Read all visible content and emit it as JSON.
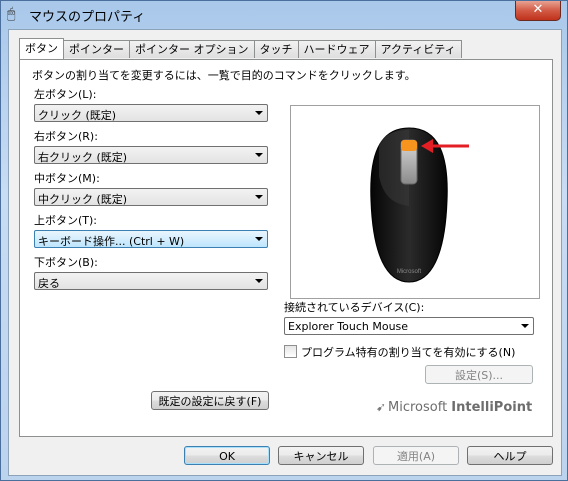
{
  "window": {
    "title": "マウスのプロパティ",
    "close_label": "✕"
  },
  "tabs": [
    "ボタン",
    "ポインター",
    "ポインター オプション",
    "タッチ",
    "ハードウェア",
    "アクティビティ"
  ],
  "panel": {
    "intro": "ボタンの割り当てを変更するには、一覧で目的のコマンドをクリックします。",
    "buttons": [
      {
        "label": "左ボタン(L):",
        "value": "クリック (既定)"
      },
      {
        "label": "右ボタン(R):",
        "value": "右クリック (既定)"
      },
      {
        "label": "中ボタン(M):",
        "value": "中クリック (既定)"
      },
      {
        "label": "上ボタン(T):",
        "value": "キーボード操作... (Ctrl + W)"
      },
      {
        "label": "下ボタン(B):",
        "value": "戻る"
      }
    ],
    "device_label": "接続されているデバイス(C):",
    "device_value": "Explorer Touch Mouse",
    "checkbox_label": "プログラム特有の割り当てを有効にする(N)",
    "settings_button": "設定(S)...",
    "restore_button": "既定の設定に戻す(F)",
    "brand_prefix": "Microsoft ",
    "brand_name": "IntelliPoint",
    "mouse_logo": "Microsoft"
  },
  "footer": {
    "ok": "OK",
    "cancel": "キャンセル",
    "apply": "適用(A)",
    "help": "ヘルプ"
  },
  "colors": {
    "highlight_button": "#f7941d",
    "arrow": "#e31e24",
    "mouse_body": "#1a1a1a"
  }
}
